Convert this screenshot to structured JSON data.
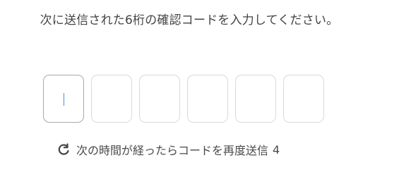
{
  "instruction": {
    "text": "次に送信された6桁の確認コードを入力してください。"
  },
  "code_input": {
    "digits": [
      "",
      "",
      "",
      "",
      "",
      ""
    ]
  },
  "resend": {
    "label": "次の時間が経ったらコードを再度送信",
    "countdown": "4",
    "icon": "refresh-icon"
  },
  "colors": {
    "caret": "#4a8fd8",
    "border": "#dadada",
    "active_border": "#a9a9a9",
    "text": "#444444"
  }
}
